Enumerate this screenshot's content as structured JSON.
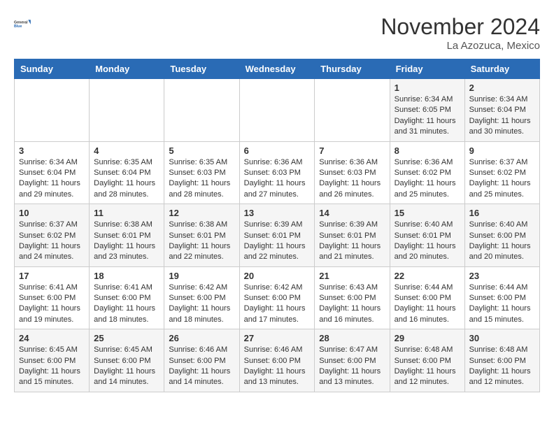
{
  "header": {
    "logo_line1": "General",
    "logo_line2": "Blue",
    "month": "November 2024",
    "location": "La Azozuca, Mexico"
  },
  "weekdays": [
    "Sunday",
    "Monday",
    "Tuesday",
    "Wednesday",
    "Thursday",
    "Friday",
    "Saturday"
  ],
  "weeks": [
    [
      {
        "day": "",
        "content": ""
      },
      {
        "day": "",
        "content": ""
      },
      {
        "day": "",
        "content": ""
      },
      {
        "day": "",
        "content": ""
      },
      {
        "day": "",
        "content": ""
      },
      {
        "day": "1",
        "content": "Sunrise: 6:34 AM\nSunset: 6:05 PM\nDaylight: 11 hours and 31 minutes."
      },
      {
        "day": "2",
        "content": "Sunrise: 6:34 AM\nSunset: 6:04 PM\nDaylight: 11 hours and 30 minutes."
      }
    ],
    [
      {
        "day": "3",
        "content": "Sunrise: 6:34 AM\nSunset: 6:04 PM\nDaylight: 11 hours and 29 minutes."
      },
      {
        "day": "4",
        "content": "Sunrise: 6:35 AM\nSunset: 6:04 PM\nDaylight: 11 hours and 28 minutes."
      },
      {
        "day": "5",
        "content": "Sunrise: 6:35 AM\nSunset: 6:03 PM\nDaylight: 11 hours and 28 minutes."
      },
      {
        "day": "6",
        "content": "Sunrise: 6:36 AM\nSunset: 6:03 PM\nDaylight: 11 hours and 27 minutes."
      },
      {
        "day": "7",
        "content": "Sunrise: 6:36 AM\nSunset: 6:03 PM\nDaylight: 11 hours and 26 minutes."
      },
      {
        "day": "8",
        "content": "Sunrise: 6:36 AM\nSunset: 6:02 PM\nDaylight: 11 hours and 25 minutes."
      },
      {
        "day": "9",
        "content": "Sunrise: 6:37 AM\nSunset: 6:02 PM\nDaylight: 11 hours and 25 minutes."
      }
    ],
    [
      {
        "day": "10",
        "content": "Sunrise: 6:37 AM\nSunset: 6:02 PM\nDaylight: 11 hours and 24 minutes."
      },
      {
        "day": "11",
        "content": "Sunrise: 6:38 AM\nSunset: 6:01 PM\nDaylight: 11 hours and 23 minutes."
      },
      {
        "day": "12",
        "content": "Sunrise: 6:38 AM\nSunset: 6:01 PM\nDaylight: 11 hours and 22 minutes."
      },
      {
        "day": "13",
        "content": "Sunrise: 6:39 AM\nSunset: 6:01 PM\nDaylight: 11 hours and 22 minutes."
      },
      {
        "day": "14",
        "content": "Sunrise: 6:39 AM\nSunset: 6:01 PM\nDaylight: 11 hours and 21 minutes."
      },
      {
        "day": "15",
        "content": "Sunrise: 6:40 AM\nSunset: 6:01 PM\nDaylight: 11 hours and 20 minutes."
      },
      {
        "day": "16",
        "content": "Sunrise: 6:40 AM\nSunset: 6:00 PM\nDaylight: 11 hours and 20 minutes."
      }
    ],
    [
      {
        "day": "17",
        "content": "Sunrise: 6:41 AM\nSunset: 6:00 PM\nDaylight: 11 hours and 19 minutes."
      },
      {
        "day": "18",
        "content": "Sunrise: 6:41 AM\nSunset: 6:00 PM\nDaylight: 11 hours and 18 minutes."
      },
      {
        "day": "19",
        "content": "Sunrise: 6:42 AM\nSunset: 6:00 PM\nDaylight: 11 hours and 18 minutes."
      },
      {
        "day": "20",
        "content": "Sunrise: 6:42 AM\nSunset: 6:00 PM\nDaylight: 11 hours and 17 minutes."
      },
      {
        "day": "21",
        "content": "Sunrise: 6:43 AM\nSunset: 6:00 PM\nDaylight: 11 hours and 16 minutes."
      },
      {
        "day": "22",
        "content": "Sunrise: 6:44 AM\nSunset: 6:00 PM\nDaylight: 11 hours and 16 minutes."
      },
      {
        "day": "23",
        "content": "Sunrise: 6:44 AM\nSunset: 6:00 PM\nDaylight: 11 hours and 15 minutes."
      }
    ],
    [
      {
        "day": "24",
        "content": "Sunrise: 6:45 AM\nSunset: 6:00 PM\nDaylight: 11 hours and 15 minutes."
      },
      {
        "day": "25",
        "content": "Sunrise: 6:45 AM\nSunset: 6:00 PM\nDaylight: 11 hours and 14 minutes."
      },
      {
        "day": "26",
        "content": "Sunrise: 6:46 AM\nSunset: 6:00 PM\nDaylight: 11 hours and 14 minutes."
      },
      {
        "day": "27",
        "content": "Sunrise: 6:46 AM\nSunset: 6:00 PM\nDaylight: 11 hours and 13 minutes."
      },
      {
        "day": "28",
        "content": "Sunrise: 6:47 AM\nSunset: 6:00 PM\nDaylight: 11 hours and 13 minutes."
      },
      {
        "day": "29",
        "content": "Sunrise: 6:48 AM\nSunset: 6:00 PM\nDaylight: 11 hours and 12 minutes."
      },
      {
        "day": "30",
        "content": "Sunrise: 6:48 AM\nSunset: 6:00 PM\nDaylight: 11 hours and 12 minutes."
      }
    ]
  ]
}
